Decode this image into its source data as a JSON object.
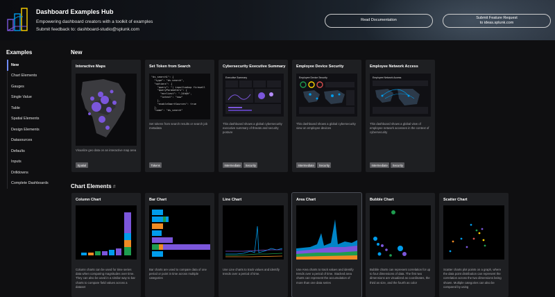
{
  "header": {
    "title": "Dashboard Examples Hub",
    "subtitle": "Empowering dashboard creators with a toolkit of examples",
    "feedback": "Submit feedback to: dashboard-studio@splunk.com",
    "docs_button": "Read Documentation",
    "feature_button_line1": "Submit Feature Request",
    "feature_button_line2": "to ideas.splunk.com"
  },
  "sidebar": {
    "title": "Examples",
    "items": [
      {
        "label": "New",
        "active": true
      },
      {
        "label": "Chart Elements"
      },
      {
        "label": "Gauges"
      },
      {
        "label": "Single Value"
      },
      {
        "label": "Table"
      },
      {
        "label": "Spatial Elements"
      },
      {
        "label": "Design Elements"
      },
      {
        "label": "Datasources"
      },
      {
        "label": "Defaults"
      },
      {
        "label": "Inputs"
      },
      {
        "label": "Drilldowns"
      },
      {
        "label": "Complete Dashboards"
      }
    ]
  },
  "sections": {
    "new_title": "New",
    "chart_title": "Chart Elements",
    "chart_hash": "#"
  },
  "new_cards": [
    {
      "title": "Interactive Maps",
      "desc": "Visualize geo data on an interactive map area",
      "tags": [
        "Spatial"
      ]
    },
    {
      "title": "Set Token from Search",
      "desc": "Set tokens from search results or search job metadata",
      "tags": [
        "Tokens"
      ]
    },
    {
      "title": "Cybersecurity Executive Summary",
      "desc": "This dashboard shows a global cybersecurity executive summary of threats and security posture",
      "tags": [
        "Intermediate",
        "Security"
      ]
    },
    {
      "title": "Employee Device Security",
      "desc": "This dashboard shows a global cybersecurity view on employee devices",
      "tags": [
        "Intermediate",
        "Security"
      ]
    },
    {
      "title": "Employee Network Access",
      "desc": "This dashboard shows a global view of employee network accesses in the context of cybersecurity",
      "tags": [
        "Intermediate",
        "Security"
      ]
    }
  ],
  "code_sample": {
    "line1": "\"ds_search1\": {",
    "line2": "  \"type\": \"ds.search\",",
    "line3": "  \"options\": {",
    "line4": "    \"query\": \"| inputlookup firewall",
    "line5": "    \"queryParameters\": {",
    "line6": "      \"earliest\": \"-24h@h\",",
    "line7": "      \"latest\": \"now\"",
    "line8": "    },",
    "line9": "    \"enableSmartSources\": true",
    "line10": "  },",
    "line11": "  \"name\": \"ds_search\""
  },
  "preview_titles": {
    "cyber": "Executive Summary",
    "device": "Employee Device Security",
    "network": "Employee Network Access"
  },
  "chart_cards": [
    {
      "title": "Column Chart",
      "desc": "Column charts can be used for time series data when comparing magnitudes over time. They can also be used in a similar way to bar charts to compare field values across a dataset"
    },
    {
      "title": "Bar Chart",
      "desc": "Bar charts are used to compare data of one period or point in time across multiple categories"
    },
    {
      "title": "Line Chart",
      "desc": "Use Line charts to track values and identify trends over a period of time."
    },
    {
      "title": "Area Chart",
      "desc": "Use Area charts to track values and identify trends over a period of time. Stacked area charts can represent the accumulation of more than one data series"
    },
    {
      "title": "Bubble Chart",
      "desc": "Bubble charts can represent correlation for up to four dimensions of data. The first two dimensions are visualized as coordinates, the third as size, and the fourth as color"
    },
    {
      "title": "Scatter Chart",
      "desc": "Scatter charts plot points on a graph, where the data point distribution can represent the correlation across the two dimensions being shown. Multiple categories can also be compared by using"
    }
  ],
  "colors": {
    "accent": "#6f8cff",
    "purple": "#7b56db",
    "teal": "#009ceb",
    "green": "#1e9c4f",
    "orange": "#f08a24",
    "yellow": "#ffd400",
    "card_bg": "#1e1f22"
  }
}
